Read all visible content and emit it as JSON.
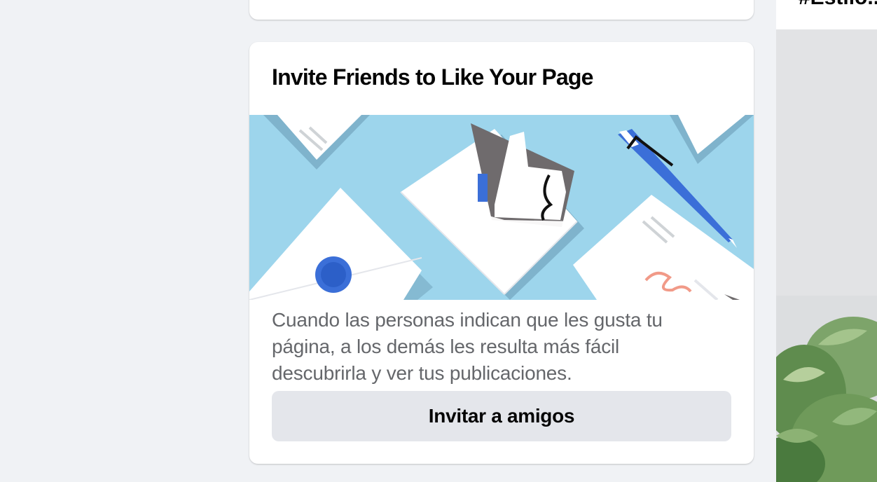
{
  "invite_card": {
    "title": "Invite Friends to Like Your Page",
    "description": "Cuando las personas indican que les gusta tu página, a los demás les resulta más fácil descubrirla y ver tus publicaciones.",
    "button_label": "Invitar a amigos"
  },
  "right_panel": {
    "caption": "#Estilo..."
  },
  "colors": {
    "page_bg": "#f0f2f5",
    "card_bg": "#ffffff",
    "illustration_bg": "#9dd5ec",
    "button_bg": "#e4e6eb",
    "desc_text": "#65676b"
  },
  "icons": {
    "illustration": "invite-envelopes-illustration",
    "photo": "plant-photo"
  }
}
